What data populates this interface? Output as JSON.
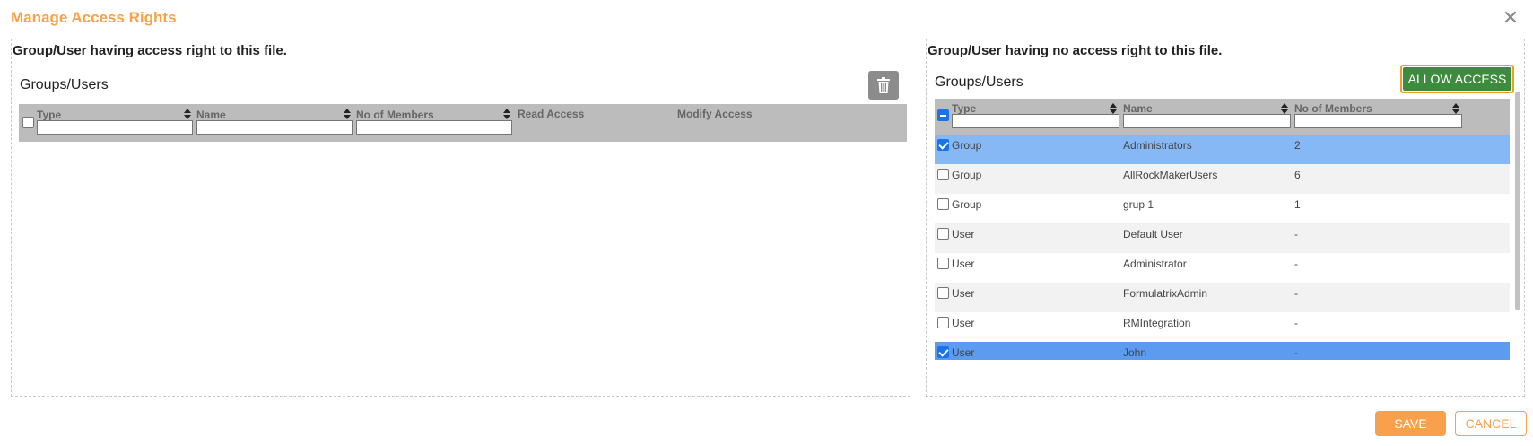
{
  "dialog": {
    "title": "Manage Access Rights",
    "close_label": "✕"
  },
  "left_panel": {
    "heading": "Group/User having access right to this file.",
    "subheading": "Groups/Users",
    "delete_icon": "trash-icon",
    "columns": [
      {
        "label": "Type",
        "sortable": true,
        "filter": ""
      },
      {
        "label": "Name",
        "sortable": true,
        "filter": ""
      },
      {
        "label": "No of Members",
        "sortable": true,
        "filter": ""
      },
      {
        "label": "Read Access",
        "sortable": false
      },
      {
        "label": "Modify Access",
        "sortable": false
      }
    ],
    "rows": []
  },
  "right_panel": {
    "heading": "Group/User having no access right to this file.",
    "subheading": "Groups/Users",
    "allow_button_label": "ALLOW ACCESS",
    "columns": [
      {
        "label": "Type",
        "sortable": true,
        "filter": ""
      },
      {
        "label": "Name",
        "sortable": true,
        "filter": ""
      },
      {
        "label": "No of Members",
        "sortable": true,
        "filter": ""
      }
    ],
    "rows": [
      {
        "type": "Group",
        "name": "Administrators",
        "members": "2",
        "checked": true
      },
      {
        "type": "Group",
        "name": "AllRockMakerUsers",
        "members": "6",
        "checked": false
      },
      {
        "type": "Group",
        "name": "grup 1",
        "members": "1",
        "checked": false
      },
      {
        "type": "User",
        "name": "Default User",
        "members": "-",
        "checked": false
      },
      {
        "type": "User",
        "name": "Administrator",
        "members": "-",
        "checked": false
      },
      {
        "type": "User",
        "name": "FormulatrixAdmin",
        "members": "-",
        "checked": false
      },
      {
        "type": "User",
        "name": "RMIntegration",
        "members": "-",
        "checked": false
      },
      {
        "type": "User",
        "name": "John",
        "members": "-",
        "checked": true
      }
    ]
  },
  "footer": {
    "save_label": "SAVE",
    "cancel_label": "CANCEL"
  },
  "colors": {
    "accent": "#f7a24a",
    "allow_green": "#3d8b3d",
    "selected_row": "#86b8f5"
  }
}
